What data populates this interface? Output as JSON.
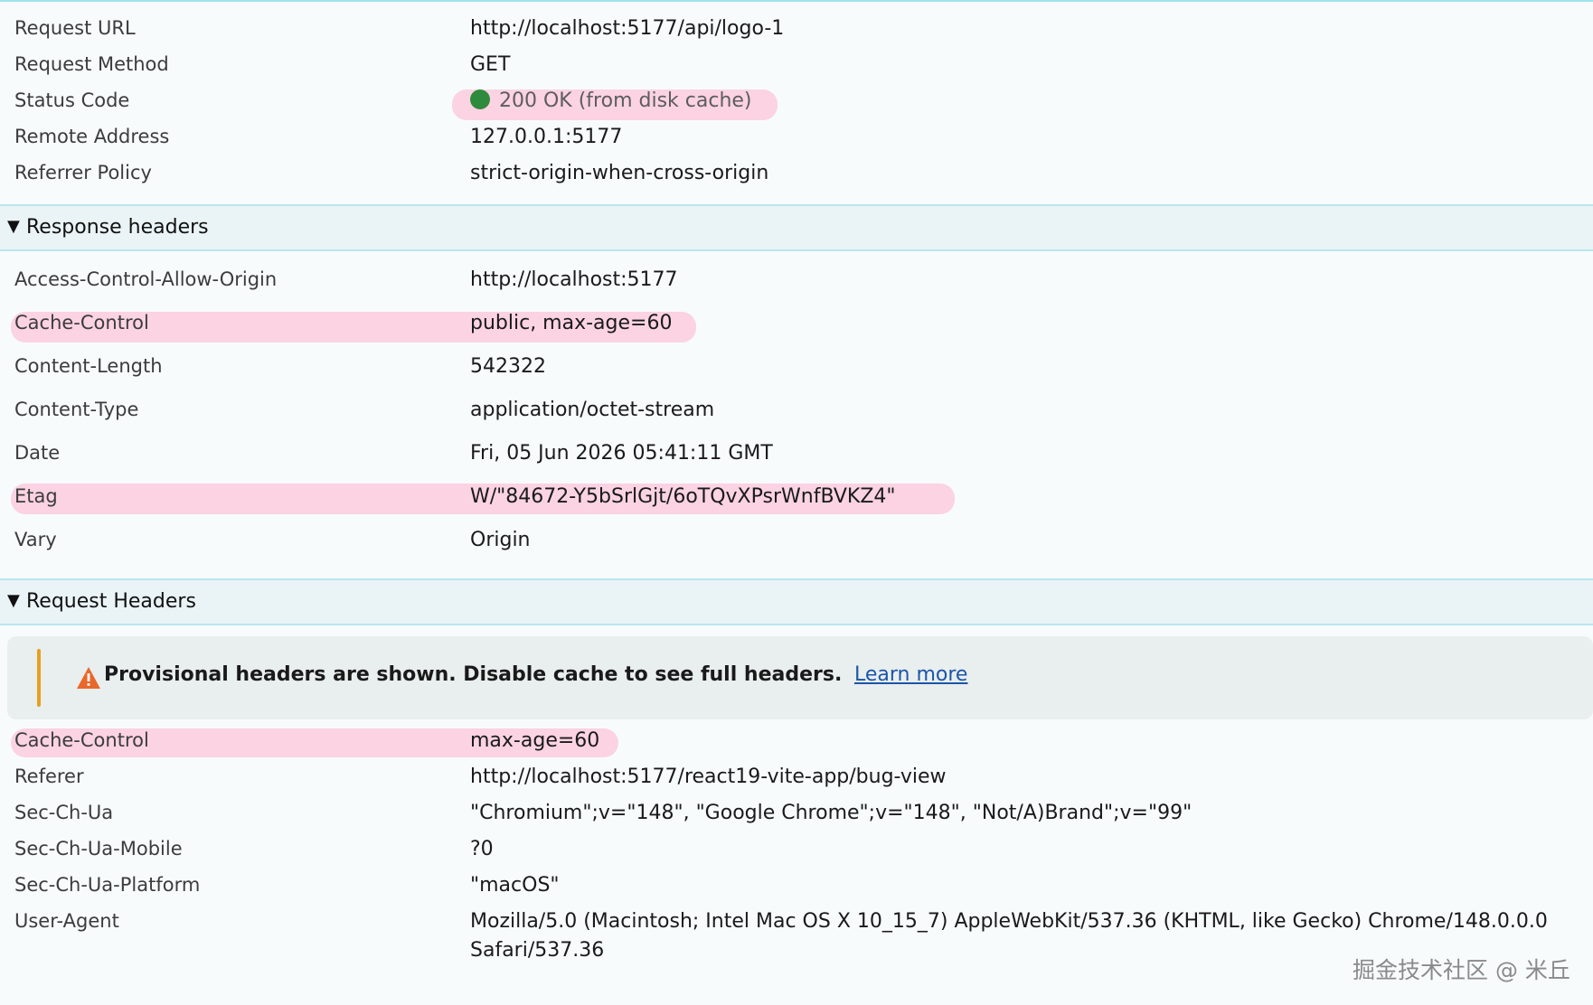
{
  "general": {
    "rows": [
      {
        "name": "Request URL",
        "value": "http://localhost:5177/api/logo-1"
      },
      {
        "name": "Request Method",
        "value": "GET"
      },
      {
        "name": "Status Code",
        "value": "200 OK (from disk cache)"
      },
      {
        "name": "Remote Address",
        "value": "127.0.0.1:5177"
      },
      {
        "name": "Referrer Policy",
        "value": "strict-origin-when-cross-origin"
      }
    ]
  },
  "response_headers": {
    "title": "Response headers",
    "rows": [
      {
        "name": "Access-Control-Allow-Origin",
        "value": "http://localhost:5177"
      },
      {
        "name": "Cache-Control",
        "value": "public, max-age=60"
      },
      {
        "name": "Content-Length",
        "value": "542322"
      },
      {
        "name": "Content-Type",
        "value": "application/octet-stream"
      },
      {
        "name": "Date",
        "value": "Fri, 05 Jun 2026 05:41:11 GMT"
      },
      {
        "name": "Etag",
        "value": "W/\"84672-Y5bSrlGjt/6oTQvXPsrWnfBVKZ4\""
      },
      {
        "name": "Vary",
        "value": "Origin"
      }
    ]
  },
  "request_headers": {
    "title": "Request Headers",
    "banner": {
      "message": "Provisional headers are shown. Disable cache to see full headers.",
      "link": "Learn more"
    },
    "rows": [
      {
        "name": "Cache-Control",
        "value": "max-age=60"
      },
      {
        "name": "Referer",
        "value": "http://localhost:5177/react19-vite-app/bug-view"
      },
      {
        "name": "Sec-Ch-Ua",
        "value": "\"Chromium\";v=\"148\", \"Google Chrome\";v=\"148\", \"Not/A)Brand\";v=\"99\""
      },
      {
        "name": "Sec-Ch-Ua-Mobile",
        "value": "?0"
      },
      {
        "name": "Sec-Ch-Ua-Platform",
        "value": "\"macOS\""
      },
      {
        "name": "User-Agent",
        "value": "Mozilla/5.0 (Macintosh; Intel Mac OS X 10_15_7) AppleWebKit/537.36 (KHTML, like Gecko) Chrome/148.0.0.0",
        "value_line2": "Safari/537.36"
      }
    ]
  },
  "watermark": "掘金技术社区 @ 米丘",
  "colors": {
    "status_ok": "#2e8b3d",
    "highlight": "#fbd3e2",
    "warning": "#e8682b",
    "banner_bar": "#e6a020",
    "link": "#1a56a8"
  },
  "icons": {
    "status": "green-dot-icon",
    "warning": "warning-triangle-icon",
    "section_toggle": "caret-down-icon"
  }
}
